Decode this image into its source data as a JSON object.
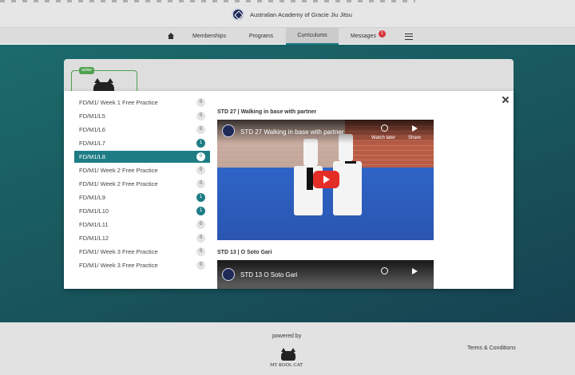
{
  "header": {
    "title": "Australian Academy of Gracie Jiu Jitsu",
    "logo_icon": "academy-logo-icon"
  },
  "nav": {
    "items": [
      {
        "label": "Memberships"
      },
      {
        "label": "Programs"
      },
      {
        "label": "Curriculums",
        "active": true
      },
      {
        "label": "Messages",
        "badge": "1"
      }
    ],
    "home_icon": "home-icon",
    "menu_icon": "hamburger-menu-icon",
    "accent": "#1e7c85",
    "badge_color": "#d9343a"
  },
  "card": {
    "status": "active",
    "status_color": "#4fa04f"
  },
  "modal": {
    "lessons": [
      {
        "label": "FD/M1/ Week 1 Free Practice",
        "count": "0"
      },
      {
        "label": "FD/M1/L5",
        "count": "0"
      },
      {
        "label": "FD/M1/L6",
        "count": "0"
      },
      {
        "label": "FD/M1/L7",
        "count": "1"
      },
      {
        "label": "FD/M1/L8",
        "count": "0",
        "selected": true
      },
      {
        "label": "FD/M1/ Week 2 Free Practice",
        "count": "0"
      },
      {
        "label": "FD/M1/ Week 2 Free Practice",
        "count": "0"
      },
      {
        "label": "FD/M1/L9",
        "count": "1"
      },
      {
        "label": "FD/M1/L10",
        "count": "1"
      },
      {
        "label": "FD/M1/L11",
        "count": "0"
      },
      {
        "label": "FD/M1/L12",
        "count": "0"
      },
      {
        "label": "FD/M1/ Week 3 Free Practice",
        "count": "0"
      },
      {
        "label": "FD/M1/ Week 3 Free Practice",
        "count": "0"
      }
    ],
    "videos": [
      {
        "heading": "STD 27 | Walking in base with partner",
        "title": "STD 27 Walking in base with partner",
        "watch_later": "Watch later",
        "share": "Share"
      },
      {
        "heading": "STD 13 | O Soto Gari",
        "title": "STD 13 O Soto Gari"
      }
    ]
  },
  "footer": {
    "powered_by": "powered by",
    "brand": "MY KOOL CAT",
    "terms": "Terms & Conditions"
  }
}
